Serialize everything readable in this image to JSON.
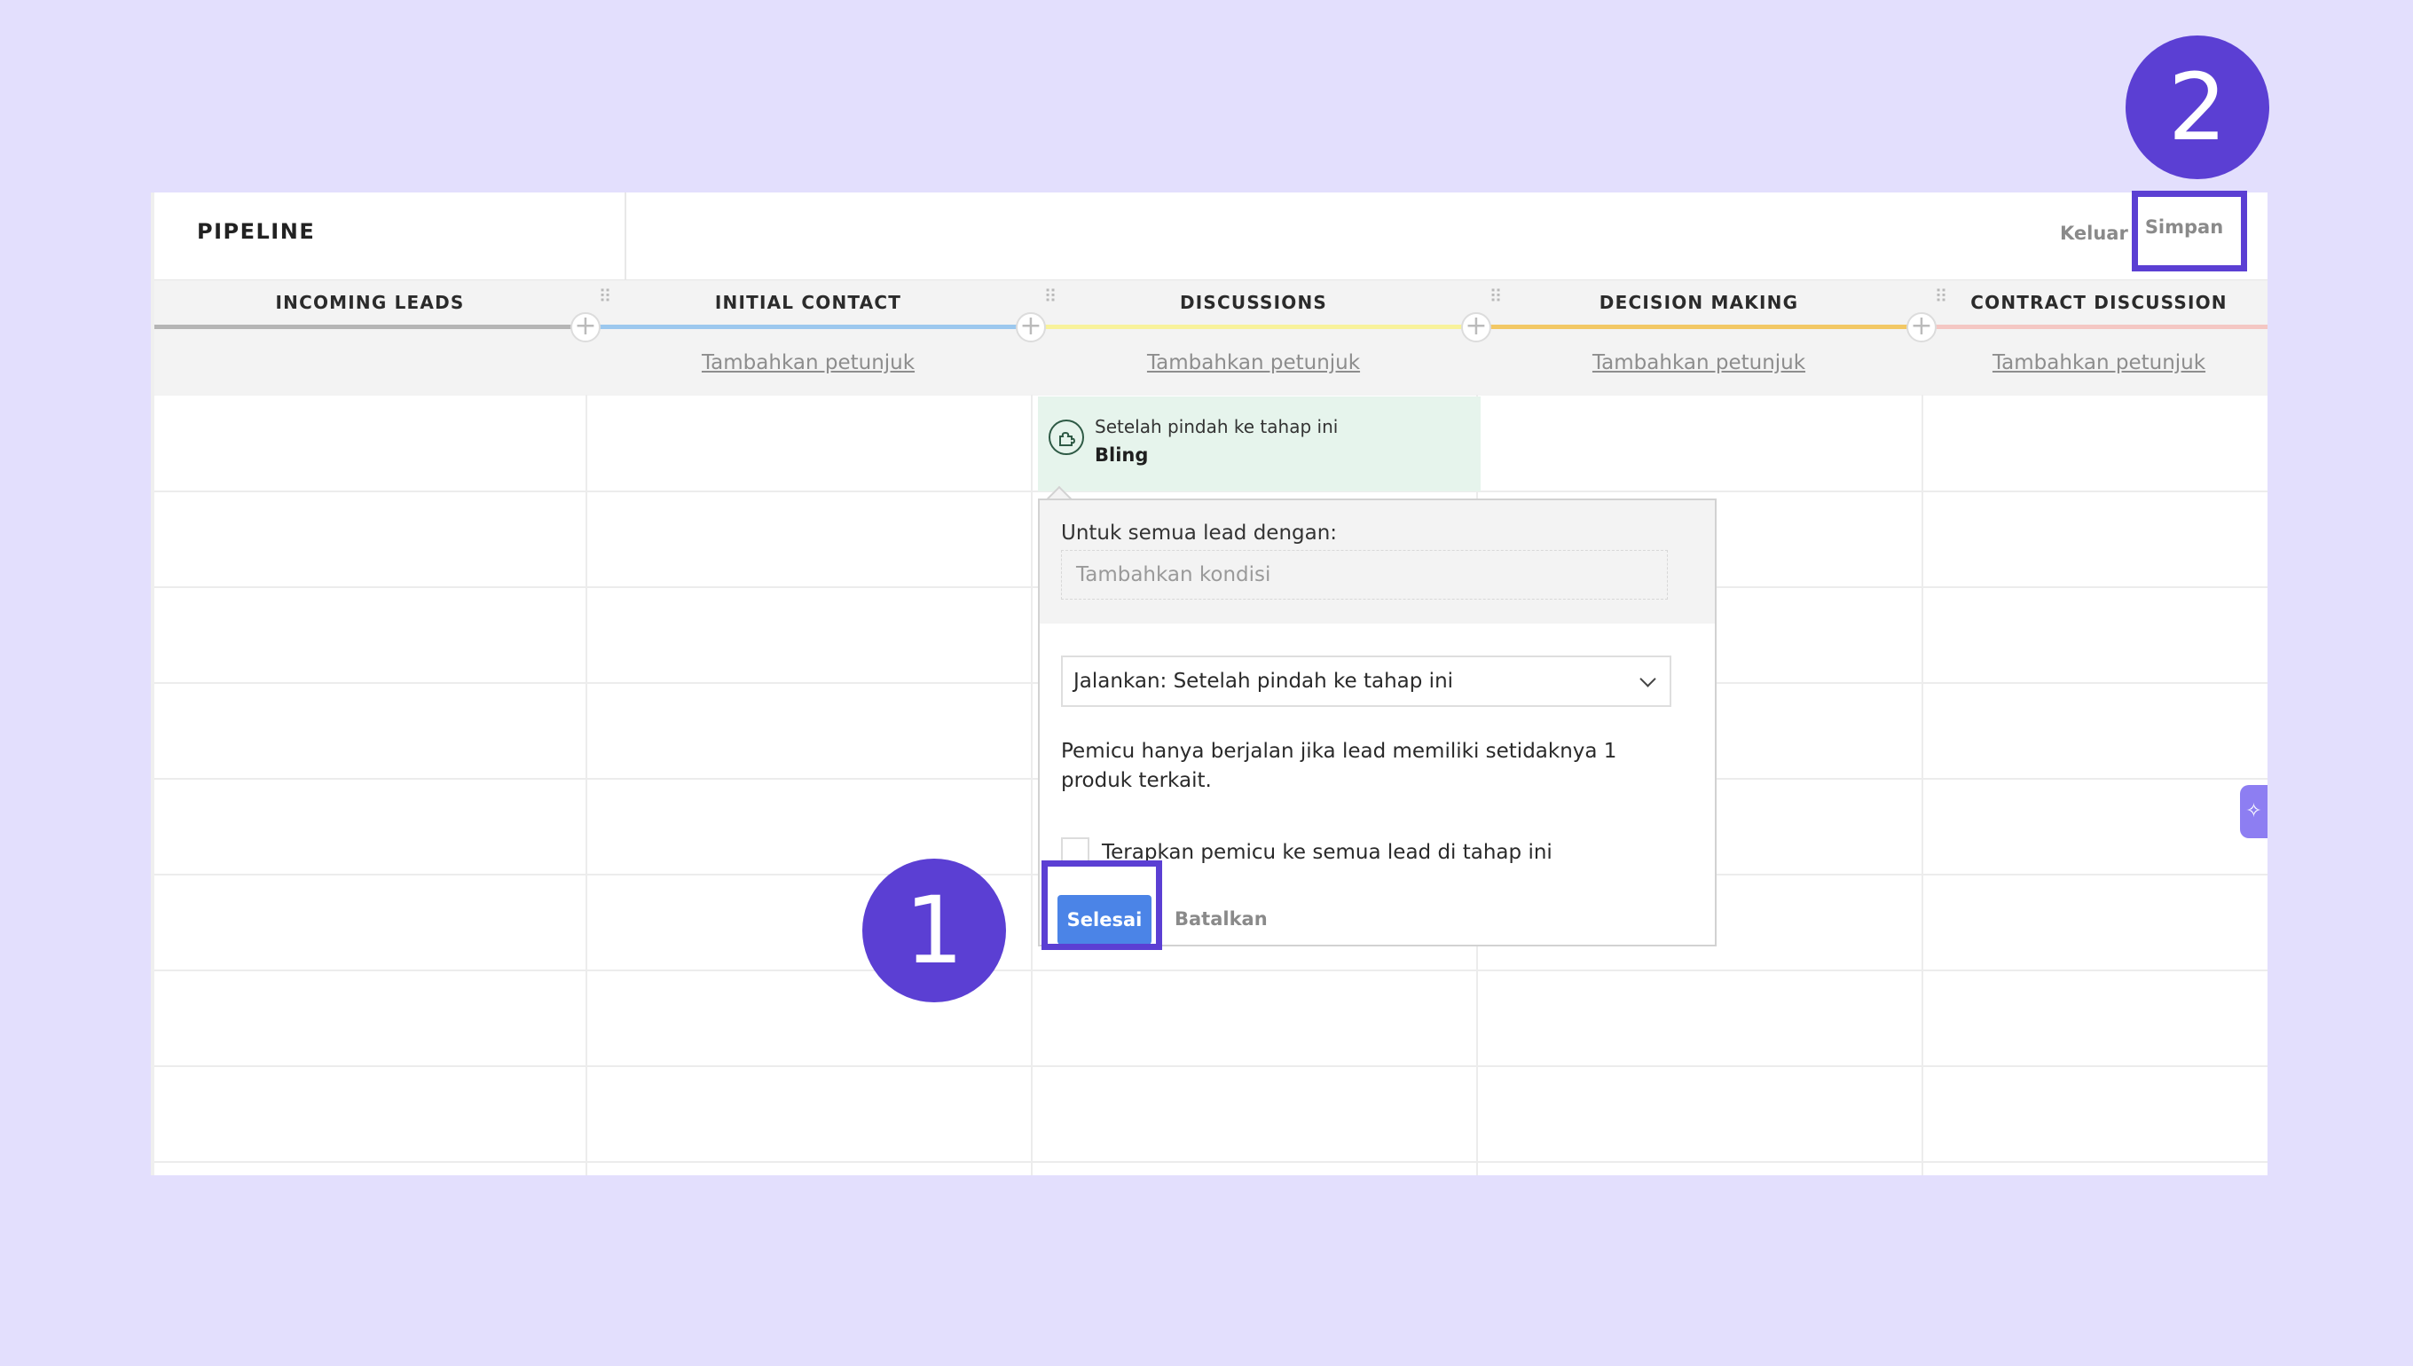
{
  "header": {
    "title": "PIPELINE",
    "exit_label": "Keluar",
    "save_label": "Simpan"
  },
  "stages": [
    {
      "name": "INCOMING LEADS",
      "color": "#b5b5b5",
      "hint": ""
    },
    {
      "name": "INITIAL CONTACT",
      "color": "#9cc8ee",
      "hint": "Tambahkan petunjuk"
    },
    {
      "name": "DISCUSSIONS",
      "color": "#f8f29b",
      "hint": "Tambahkan petunjuk"
    },
    {
      "name": "DECISION MAKING",
      "color": "#f2c864",
      "hint": "Tambahkan petunjuk"
    },
    {
      "name": "CONTRACT DISCUSSION",
      "color": "#f4c7c3",
      "hint": "Tambahkan petunjuk"
    }
  ],
  "trigger": {
    "label": "Setelah pindah ke tahap ini",
    "name": "Bling"
  },
  "popup": {
    "condition_label": "Untuk semua lead dengan:",
    "condition_placeholder": "Tambahkan kondisi",
    "run_select_value": "Jalankan: Setelah pindah ke tahap ini",
    "note": "Pemicu hanya berjalan jika lead memiliki setidaknya 1 produk terkait.",
    "checkbox_label": "Terapkan pemicu ke semua lead di tahap ini",
    "done_label": "Selesai",
    "cancel_label": "Batalkan"
  },
  "side_tab_icon": "sparkle-icon",
  "badges": {
    "step1": "1",
    "step2": "2"
  },
  "colors": {
    "accent": "#5b3fd3",
    "primary_button": "#4b84e7",
    "background": "#e3dffd"
  }
}
